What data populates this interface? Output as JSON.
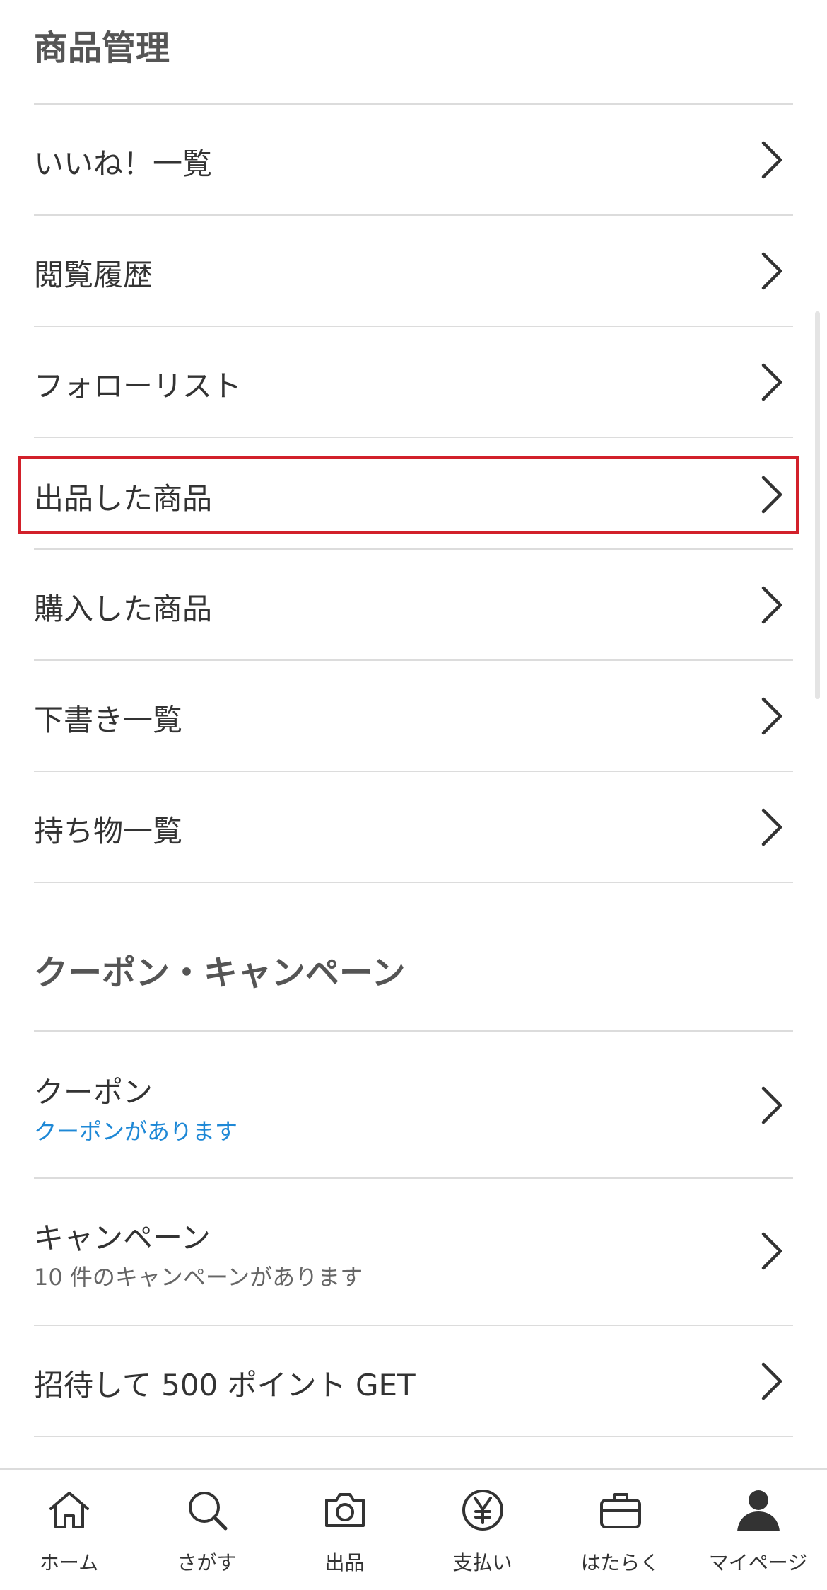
{
  "sections": {
    "product_management": {
      "title": "商品管理",
      "items": [
        {
          "label": "いいね！一覧"
        },
        {
          "label": "閲覧履歴"
        },
        {
          "label": "フォローリスト"
        },
        {
          "label": "出品した商品"
        },
        {
          "label": "購入した商品"
        },
        {
          "label": "下書き一覧"
        },
        {
          "label": "持ち物一覧"
        }
      ]
    },
    "coupon_campaign": {
      "title": "クーポン・キャンペーン",
      "items": [
        {
          "label": "クーポン",
          "sub": "クーポンがあります",
          "sub_color": "#1e88d6"
        },
        {
          "label": "キャンペーン",
          "sub": "10 件のキャンペーンがあります",
          "sub_color": "#666666"
        },
        {
          "label": "招待して 500 ポイント GET"
        }
      ]
    }
  },
  "highlighted_item": "出品した商品",
  "highlight_color": "#d2202a",
  "tabbar": {
    "items": [
      {
        "label": "ホーム",
        "icon": "home-icon"
      },
      {
        "label": "さがす",
        "icon": "search-icon"
      },
      {
        "label": "出品",
        "icon": "camera-icon"
      },
      {
        "label": "支払い",
        "icon": "yen-icon"
      },
      {
        "label": "はたらく",
        "icon": "briefcase-icon"
      },
      {
        "label": "マイページ",
        "icon": "person-icon"
      }
    ]
  }
}
